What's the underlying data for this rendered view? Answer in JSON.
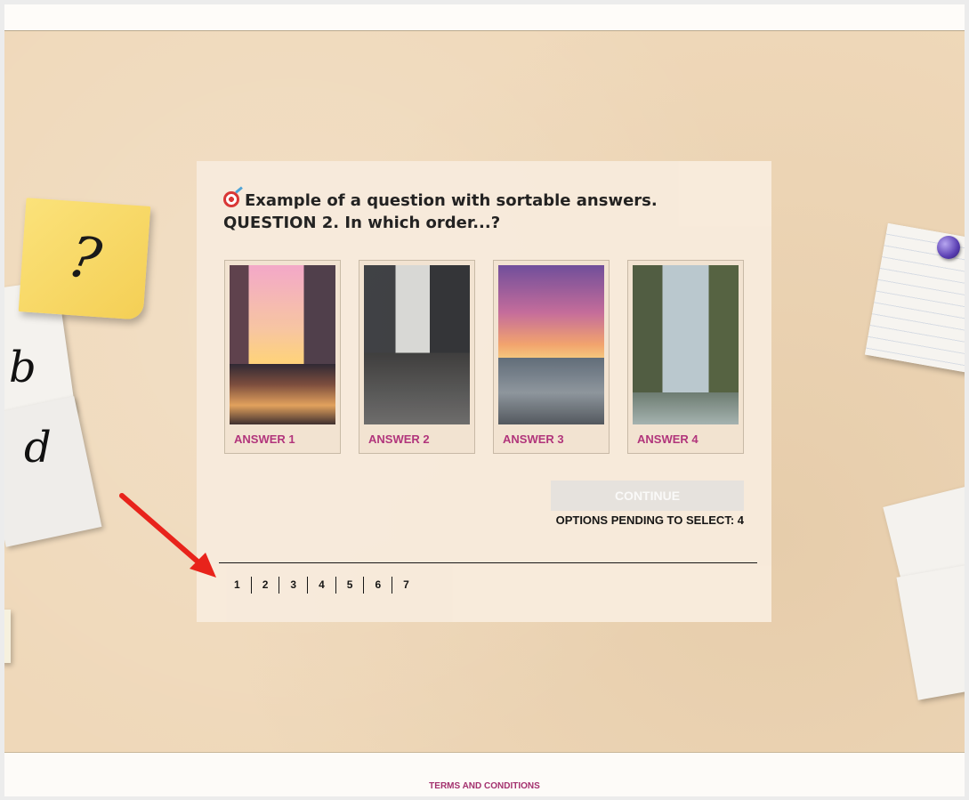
{
  "question": {
    "icon": "target-icon",
    "text": "Example of a question with sortable answers. QUESTION 2. In which order...?"
  },
  "answers": [
    {
      "label": "ANSWER 1"
    },
    {
      "label": "ANSWER 2"
    },
    {
      "label": "ANSWER 3"
    },
    {
      "label": "ANSWER 4"
    }
  ],
  "continue_button": {
    "label": "CONTINUE",
    "enabled": false
  },
  "pending_text": "OPTIONS PENDING TO SELECT: 4",
  "pagination": [
    "1",
    "2",
    "3",
    "4",
    "5",
    "6",
    "7"
  ],
  "decor": {
    "sticky_note": "?",
    "letter_b": "b",
    "letter_d": "d"
  },
  "footer": {
    "terms": "TERMS AND CONDITIONS"
  },
  "colors": {
    "accent": "#b0307a",
    "arrow": "#e8231b",
    "sticky": "#f7d75f"
  }
}
